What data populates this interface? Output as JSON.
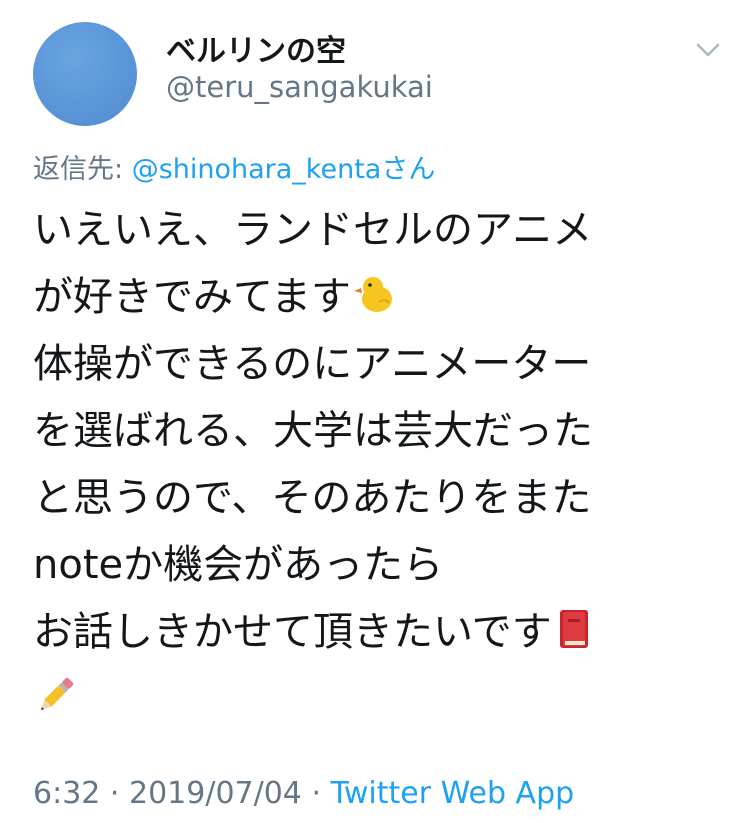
{
  "user": {
    "display_name": "ベルリンの空",
    "handle": "@teru_sangakukai"
  },
  "reply": {
    "label": "返信先: ",
    "target": "@shinohara_kentaさん"
  },
  "tweet": {
    "lines": [
      "いえいえ、ランドセルのアニメ",
      "が好きでみてます",
      "体操ができるのにアニメーター",
      "を選ばれる、大学は芸大だった",
      "と思うので、そのあたりをまた",
      "noteか機会があったら",
      "お話しきかせて頂きたいです",
      ""
    ],
    "emojis": [
      "chick-emoji",
      "book-emoji",
      "pencil-emoji"
    ]
  },
  "footer": {
    "time": "6:32",
    "separator": " · ",
    "date": "2019/07/04",
    "source": "Twitter Web App"
  },
  "colors": {
    "text": "#14171a",
    "secondary": "#657786",
    "link": "#1da1f2",
    "avatar": "#5a96d8"
  }
}
